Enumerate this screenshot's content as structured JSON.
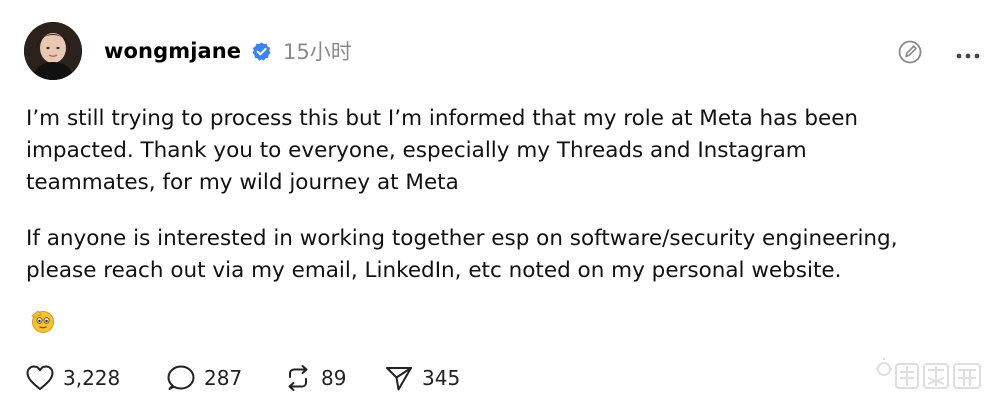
{
  "post": {
    "username": "wongmjane",
    "time": "15小时",
    "paragraph1": [
      "I’m still trying to process this but I’m informed that my role at Meta has been",
      "impacted. Thank you to everyone, especially my Threads and Instagram",
      "teammates, for my wild journey at Meta"
    ],
    "paragraph2": [
      "If anyone is interested in working together esp on software/security engineering,",
      "please reach out via my email, LinkedIn, etc noted on my personal website."
    ],
    "emoji": "saluting-face-emoji"
  },
  "actions": {
    "likes": "3,228",
    "replies": "287",
    "reposts": "89",
    "shares": "345"
  },
  "icons": {
    "verified": "verified-badge-icon",
    "edit": "edit-icon",
    "more": "more-icon",
    "like": "heart-icon",
    "reply": "comment-icon",
    "repost": "repost-icon",
    "share": "send-icon"
  },
  "colors": {
    "verified": "#3b82f6",
    "muted": "#8a8a8a",
    "text": "#111111"
  }
}
